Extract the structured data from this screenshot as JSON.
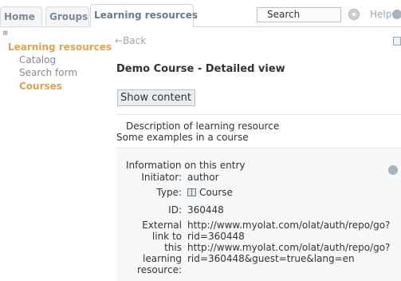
{
  "tabs": {
    "home": "Home",
    "groups": "Groups",
    "learning_resources": "Learning resources"
  },
  "search": {
    "value": "Search"
  },
  "help": {
    "label": "Help"
  },
  "sidebar": {
    "toggle": "⊞",
    "root": "Learning resources",
    "items": [
      "Catalog",
      "Search form",
      "Courses"
    ]
  },
  "main": {
    "back_label": "←Back",
    "title": "Demo Course - Detailed view",
    "show_content_label": "Show content",
    "description_heading": "Description of learning resource",
    "description_text": "Some examples in a course",
    "info_heading": "Information on this entry",
    "rows": {
      "initiator": {
        "label": "Initiator:",
        "value": "author"
      },
      "type": {
        "label": "Type:",
        "value": "Course"
      },
      "id": {
        "label": "ID:",
        "value": "360448"
      },
      "link": {
        "label_lines": [
          "External",
          "link to",
          "this",
          "learning",
          "resource:"
        ],
        "value_lines": [
          "http://www.myolat.com/olat/auth/repo/go?",
          "rid=360448",
          "http://www.myolat.com/olat/auth/repo/go?",
          "rid=360448&guest=true&lang=en"
        ]
      }
    }
  },
  "icons": {
    "search_go": "go-circle-icon",
    "help": "help-circle-icon",
    "print": "print-icon",
    "course": "course-book-icon",
    "info_help": "help-circle-icon"
  },
  "colors": {
    "accent_orange": "#e6a14a",
    "tab_text": "#7a8a9a",
    "link_gray": "#9aa8b4"
  }
}
